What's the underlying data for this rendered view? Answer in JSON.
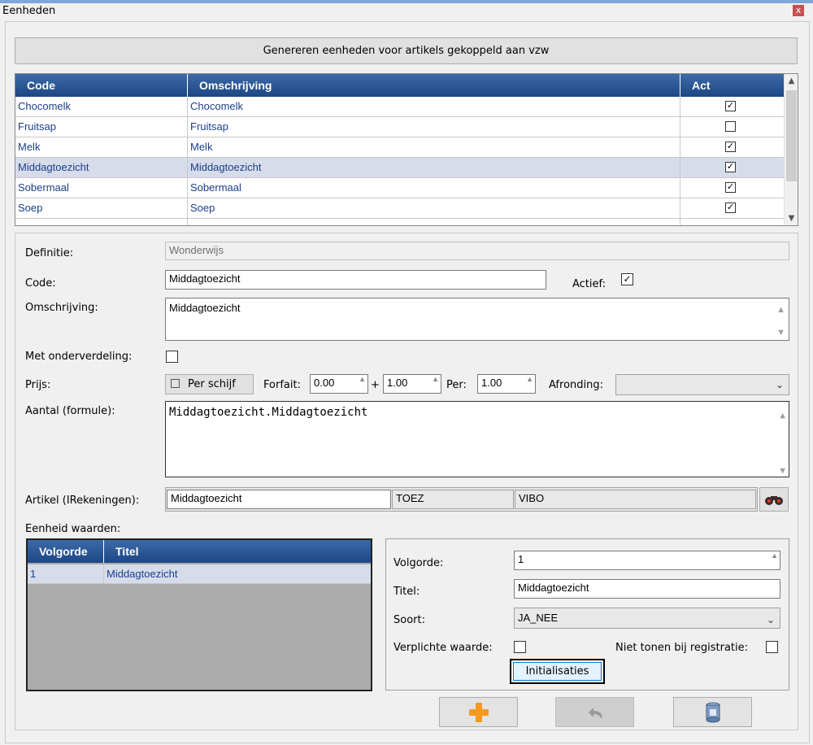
{
  "window": {
    "title": "Eenheden",
    "close_glyph": "x"
  },
  "generate_button": "Genereren eenheden voor artikels gekoppeld aan vzw",
  "grid": {
    "columns": {
      "code": "Code",
      "omschrijving": "Omschrijving",
      "act": "Act"
    },
    "rows": [
      {
        "code": "Chocomelk",
        "omschrijving": "Chocomelk",
        "act": true
      },
      {
        "code": "Fruitsap",
        "omschrijving": "Fruitsap",
        "act": false
      },
      {
        "code": "Melk",
        "omschrijving": "Melk",
        "act": true
      },
      {
        "code": "Middagtoezicht",
        "omschrijving": "Middagtoezicht",
        "act": true,
        "selected": true
      },
      {
        "code": "Sobermaal",
        "omschrijving": "Sobermaal",
        "act": true
      },
      {
        "code": "Soep",
        "omschrijving": "Soep",
        "act": true
      }
    ]
  },
  "form": {
    "definitie_label": "Definitie:",
    "definitie_value": "Wonderwijs",
    "code_label": "Code:",
    "code_value": "Middagtoezicht",
    "actief_label": "Actief:",
    "actief_checked": true,
    "omschrijving_label": "Omschrijving:",
    "omschrijving_value": "Middagtoezicht",
    "onderverdeling_label": "Met onderverdeling:",
    "prijs_label": "Prijs:",
    "per_schijf_label": "Per schijf",
    "forfait_label": "Forfait:",
    "forfait_value": "0.00",
    "plus_label": "+",
    "plus_value": "1.00",
    "per_label": "Per:",
    "per_value": "1.00",
    "afronding_label": "Afronding:",
    "aantal_label": "Aantal (formule):",
    "aantal_value": "Middagtoezicht.Middagtoezicht",
    "artikel_label": "Artikel (IRekeningen):",
    "artikel_name": "Middagtoezicht",
    "artikel_code": "TOEZ",
    "artikel_vzw": "VIBO",
    "eenheid_waarden_label": "Eenheid waarden:"
  },
  "mini_grid": {
    "columns": {
      "volgorde": "Volgorde",
      "titel": "Titel"
    },
    "rows": [
      {
        "volgorde": "1",
        "titel": "Middagtoezicht"
      }
    ]
  },
  "detail": {
    "volgorde_label": "Volgorde:",
    "volgorde_value": "1",
    "titel_label": "Titel:",
    "titel_value": "Middagtoezicht",
    "soort_label": "Soort:",
    "soort_value": "JA_NEE",
    "verplicht_label": "Verplichte waarde:",
    "niet_tonen_label": "Niet tonen bij registratie:",
    "init_button": "Initialisaties"
  },
  "colors": {
    "header_blue": "#1d4684",
    "row_text": "#1c3f8a",
    "selected_row": "#d6dcea",
    "add_icon": "#f39a1f"
  },
  "icons": {
    "add": "plus-icon",
    "undo": "undo-icon",
    "save": "save-icon",
    "search": "binoculars-icon"
  }
}
